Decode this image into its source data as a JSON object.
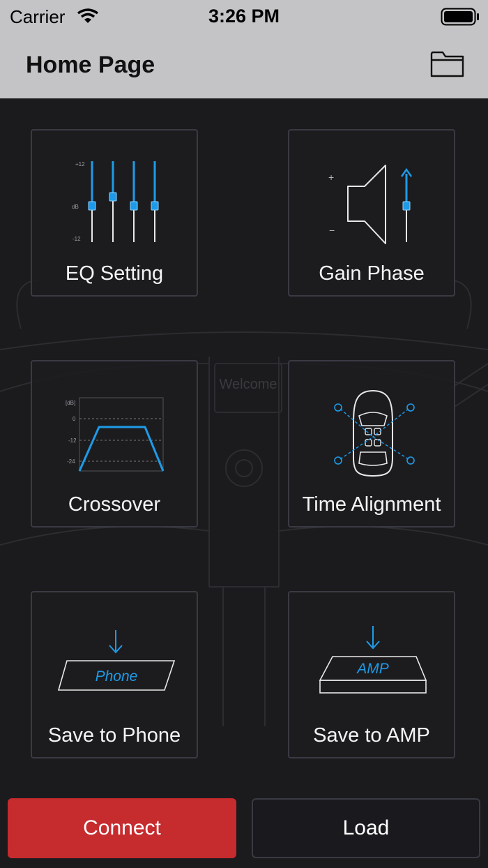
{
  "status_bar": {
    "carrier": "Carrier",
    "time": "3:26 PM"
  },
  "header": {
    "title": "Home Page",
    "folder_icon": "folder-icon"
  },
  "background": {
    "display_text": "Welcome"
  },
  "tiles": [
    {
      "label": "EQ Setting",
      "icon": "eq-sliders-icon",
      "scale": {
        "top": "+12",
        "mid": "dB",
        "bottom": "-12"
      }
    },
    {
      "label": "Gain Phase",
      "icon": "speaker-gain-icon",
      "scale": {
        "plus": "+",
        "minus": "−"
      }
    },
    {
      "label": "Crossover",
      "icon": "crossover-graph-icon",
      "scale": {
        "unit": "[dB]",
        "t0": "0",
        "t1": "-12",
        "t2": "-24"
      }
    },
    {
      "label": "Time Alignment",
      "icon": "car-speakers-icon"
    },
    {
      "label": "Save to Phone",
      "icon": "save-phone-icon",
      "device": "Phone"
    },
    {
      "label": "Save to AMP",
      "icon": "save-amp-icon",
      "device": "AMP"
    }
  ],
  "buttons": {
    "connect": "Connect",
    "load": "Load"
  },
  "colors": {
    "accent": "#1e9be8",
    "connect": "#c62b2e",
    "header_bg": "#c4c4c6",
    "page_bg": "#1b1b1d"
  }
}
